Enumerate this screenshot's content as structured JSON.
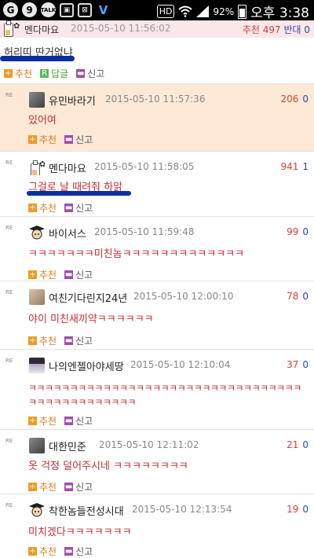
{
  "statusbar": {
    "icons": [
      "G",
      "9",
      "TALK",
      "▣",
      "⊠",
      "V"
    ],
    "hd": "HD",
    "battery": "92%",
    "time": "오후 3:38"
  },
  "post": {
    "author": "멘다마요",
    "date": "2015-05-10 11:56:02",
    "recommend": "추천 497",
    "oppose": "반대 0",
    "title": "허리띠 딴거없냐",
    "actions": {
      "recommend": "추천",
      "reply": "답글",
      "report": "신고"
    }
  },
  "comment_actions": {
    "recommend": "추천",
    "report": "신고"
  },
  "re_label": "RE",
  "comments": [
    {
      "author": "유민바라기",
      "date": "2015-05-10 11:57:36",
      "score": "206",
      "zero": "0",
      "text": "있어여"
    },
    {
      "author": "멘다마요",
      "date": "2015-05-10 11:58:05",
      "score": "941",
      "zero": "1",
      "text": "그걸로 날 때려줘 하앍"
    },
    {
      "author": "바이서스",
      "date": "2015-05-10 11:59:48",
      "score": "99",
      "zero": "0",
      "text": "ㅋㅋㅋㅋㅋㅋㅋ미친놈ㅋㅋㅋㅋㅋㅋㅋㅋㅋㅋㅋㅋㅋ"
    },
    {
      "author": "여친기다린지24년",
      "date": "2015-05-10 12:00:10",
      "score": "78",
      "zero": "0",
      "text": "야이 미친새끼약ㅋㅋㅋㅋㅋㅋ"
    },
    {
      "author": "나의엔젤아야세땅",
      "date": "2015-05-10 12:10:04",
      "score": "37",
      "zero": "0",
      "text": "ㅋㅋㅋㅋㅋㅋㅋㅋㅋㅋㅋㅋㅋㅋㅋㅋㅋㅋㅋㅋㅋㅋㅋㅋㅋㅋㅋㅋㅋㅋㅋㅋㅋㅋㅋㅋㅋㅋㅋㅋㅋㅋㅋㅋㅋㅋ"
    },
    {
      "author": "대한민준",
      "date": "2015-05-10 12:11:02",
      "score": "21",
      "zero": "0",
      "text": "옷 걱정 덜어주시네 ㅋㅋㅋㅋㅋㅋㅋㅋ"
    },
    {
      "author": "착한놈들전성시대",
      "date": "2015-05-10 12:13:54",
      "score": "19",
      "zero": "0",
      "text": "미치겠다ㅋㅋㅋㅋㅋㅋㅋ"
    }
  ]
}
